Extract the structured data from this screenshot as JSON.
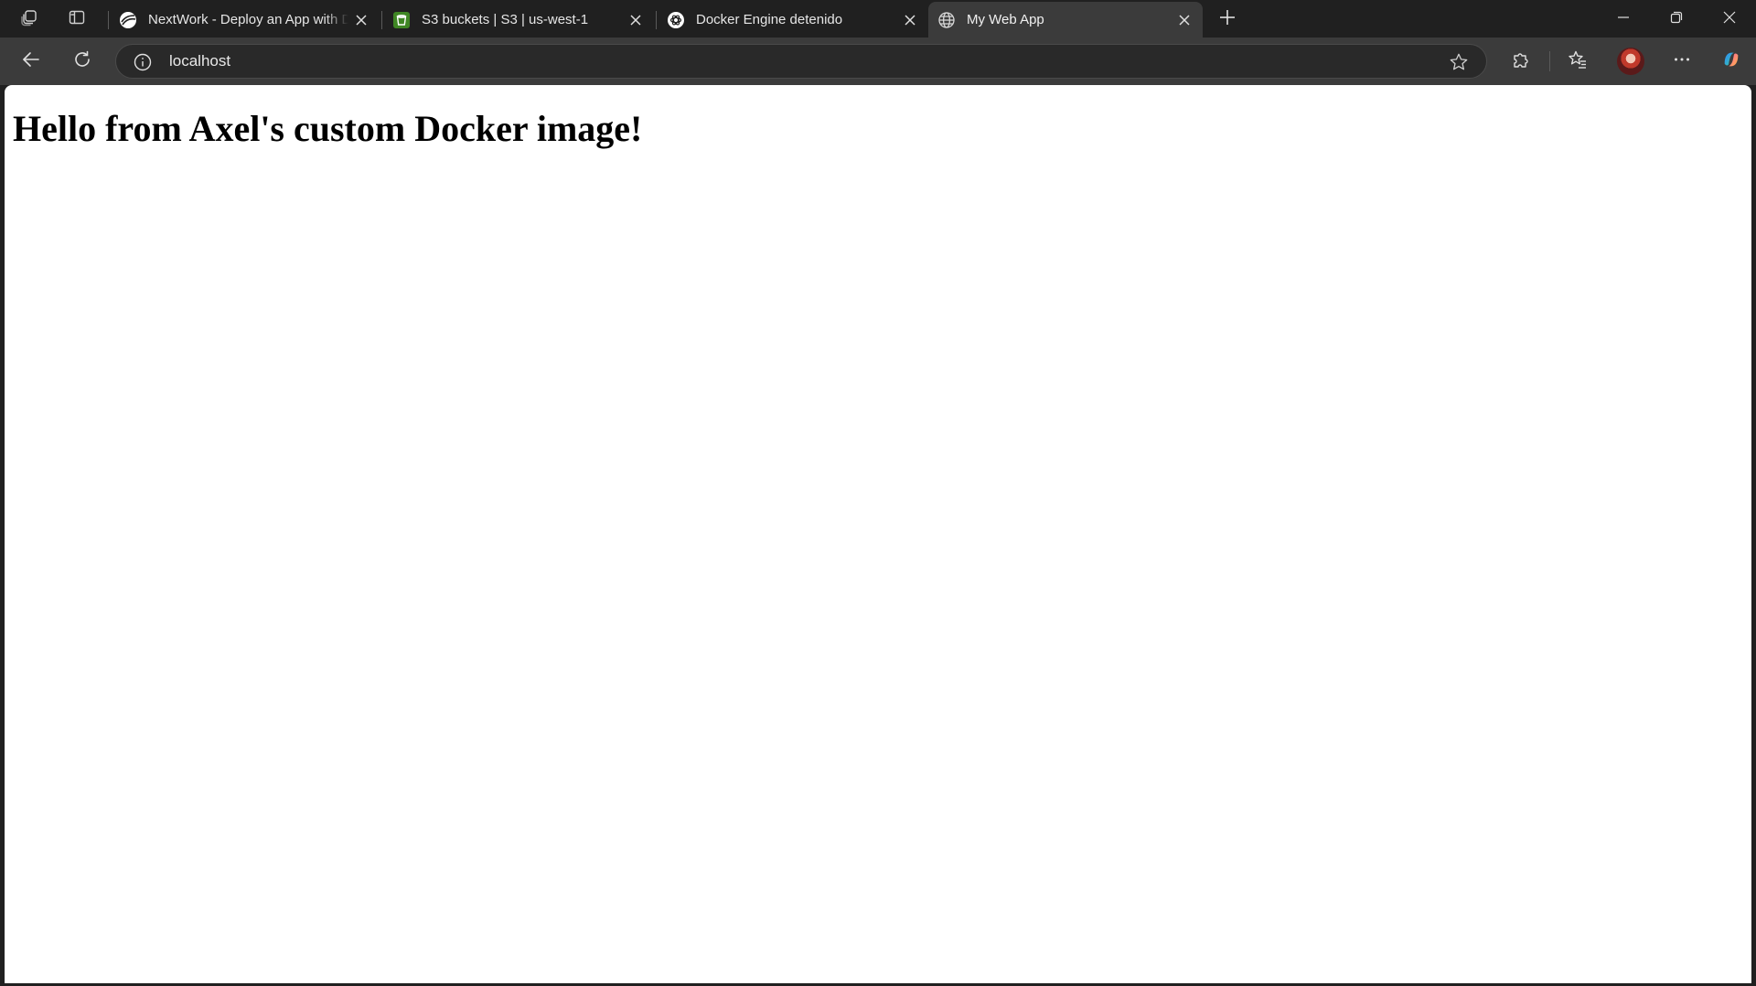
{
  "browser": {
    "tabs": [
      {
        "title": "NextWork - Deploy an App with Docker",
        "favicon": "nextwork-icon",
        "active": false
      },
      {
        "title": "S3 buckets | S3 | us-west-1",
        "favicon": "aws-s3-icon",
        "active": false
      },
      {
        "title": "Docker Engine detenido",
        "favicon": "chatgpt-icon",
        "active": false
      },
      {
        "title": "My Web App",
        "favicon": "globe-icon",
        "active": true
      }
    ],
    "address": {
      "url": "localhost"
    },
    "icons": {
      "workspaces": "workspaces-icon",
      "tab_actions": "tab-actions-icon",
      "new_tab": "plus-icon",
      "back": "back-arrow-icon",
      "refresh": "refresh-icon",
      "site_info": "info-icon",
      "favorite": "star-icon",
      "extensions": "puzzle-icon",
      "favorites": "favorites-icon",
      "more": "more-icon",
      "copilot": "copilot-icon",
      "minimize": "minimize-icon",
      "restore": "restore-icon",
      "close_window": "close-icon"
    },
    "colors": {
      "tabstrip_bg": "#202020",
      "toolbar_bg": "#3b3b3b",
      "active_tab_bg": "#3b3b3b",
      "s3_green": "#3f8624"
    }
  },
  "page": {
    "heading": "Hello from Axel's custom Docker image!"
  }
}
